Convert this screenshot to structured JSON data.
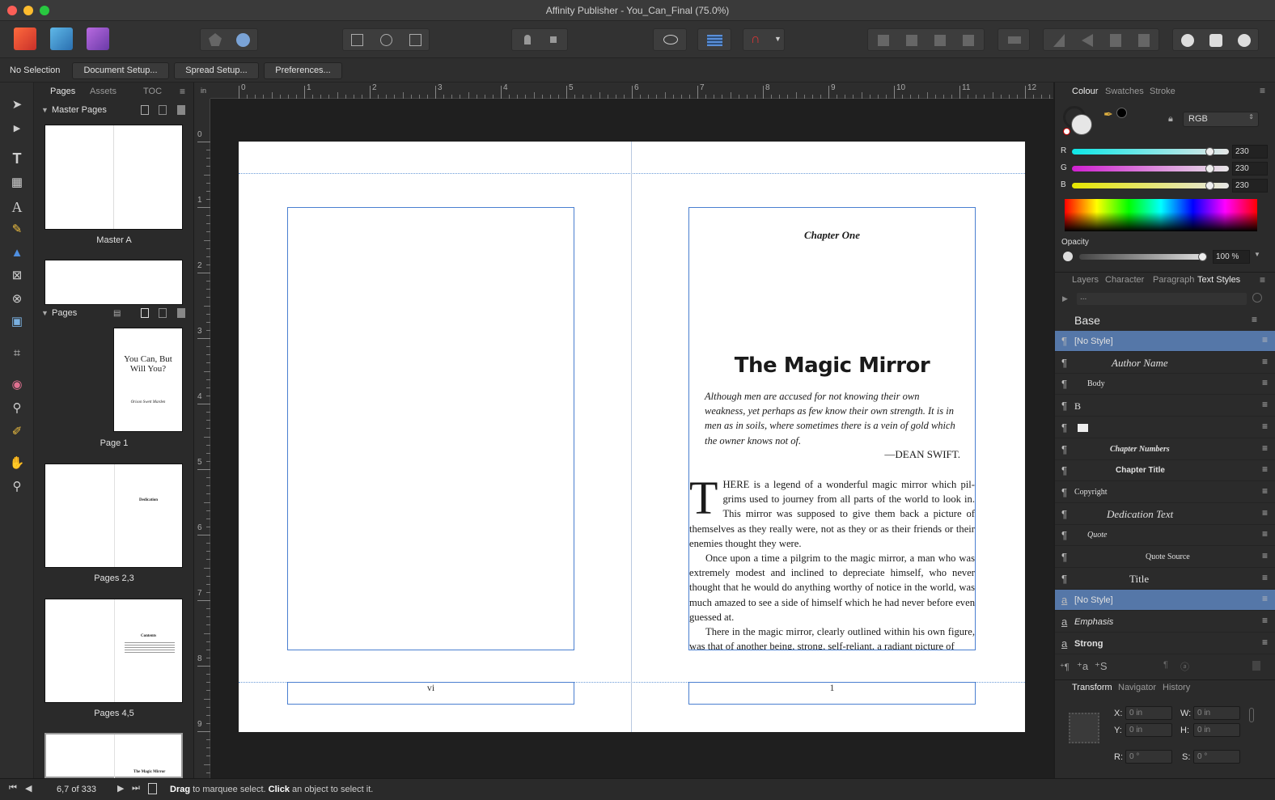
{
  "window": {
    "title": "Affinity Publisher - You_Can_Final (75.0%)"
  },
  "context_bar": {
    "selection": "No Selection",
    "document_setup": "Document Setup...",
    "spread_setup": "Spread Setup...",
    "preferences": "Preferences..."
  },
  "pages_panel": {
    "tabs": [
      "Pages",
      "Assets",
      "TOC"
    ],
    "master_pages_header": "Master Pages",
    "pages_header": "Pages",
    "master_a_label": "Master A",
    "page1_label": "Page 1",
    "page1_thumb_title": "You Can, But Will You?",
    "page1_thumb_author": "Orison Swett Marden",
    "pages23_label": "Pages 2,3",
    "pages23_thumb_text": "Dedication",
    "pages45_label": "Pages 4,5",
    "pages45_thumb_text": "Contents",
    "pages67_thumb_text": "The Magic Mirror"
  },
  "ruler": {
    "h_ticks": [
      "0",
      "1",
      "2",
      "3",
      "4",
      "5",
      "6",
      "7",
      "8",
      "9",
      "10",
      "11",
      "12"
    ],
    "v_ticks": [
      "0",
      "1",
      "2",
      "3",
      "4",
      "5",
      "6",
      "7",
      "8",
      "9"
    ],
    "unit": "in"
  },
  "spread": {
    "chapter_label": "Chapter One",
    "chapter_title": "The Magic Mirror",
    "epigraph": "Although men are accused for not knowing their own weakness, yet perhaps as few know their own strength. It is in men as in soils, where sometimes there is a vein of gold which the owner knows not of.",
    "epigraph_source": "—DEAN SWIFT.",
    "drop_cap": "T",
    "para1": "HERE is a legend of a wonderful magic mirror which pil­grims used to journey from all parts of the world to look in. This mirror was supposed to give them back a picture of themselves as they really were, not as they or as their friends or their enemies thought they were.",
    "para2": "Once upon a time a pilgrim to the magic mirror, a man who was extremely modest and inclined to depreciate himself, who never thought that he would do anything worthy of notice in the world, was much amazed to see a side of himself which he had never before even guessed at.",
    "para3": "There in the magic mirror, clearly outlined within his own figure, was that of another being, strong, self-reliant, a radiant picture of",
    "left_folio": "vi",
    "right_folio": "1"
  },
  "colour_panel": {
    "tabs": [
      "Colour",
      "Swatches",
      "Stroke"
    ],
    "model": "RGB",
    "r_label": "R",
    "r": "230",
    "g_label": "G",
    "g": "230",
    "b_label": "B",
    "b": "230",
    "opacity_label": "Opacity",
    "opacity": "100 %"
  },
  "styles_panel": {
    "tabs": [
      "Layers",
      "Character",
      "Paragraph",
      "Text Styles"
    ],
    "search_value": "...",
    "group": "Base",
    "paragraph_styles": [
      {
        "name": "[No Style]"
      },
      {
        "name": "Author Name"
      },
      {
        "name": "Body"
      },
      {
        "name": "B"
      },
      {
        "name": ""
      },
      {
        "name": "Chapter Numbers"
      },
      {
        "name": "Chapter Title"
      },
      {
        "name": "Copyright"
      },
      {
        "name": "Dedication Text"
      },
      {
        "name": "Quote"
      },
      {
        "name": "Quote Source"
      },
      {
        "name": "Title"
      }
    ],
    "character_styles": [
      {
        "name": "[No Style]"
      },
      {
        "name": "Emphasis"
      },
      {
        "name": "Strong"
      }
    ]
  },
  "transform_panel": {
    "tabs": [
      "Transform",
      "Navigator",
      "History"
    ],
    "x_label": "X:",
    "x": "0 in",
    "y_label": "Y:",
    "y": "0 in",
    "w_label": "W:",
    "w": "0 in",
    "h_label": "H:",
    "h": "0 in",
    "r_label": "R:",
    "r": "0 °",
    "s_label": "S:",
    "s": "0 °"
  },
  "status": {
    "page_indicator": "6,7 of 333",
    "hint_drag": "Drag",
    "hint_mid": " to marquee select. ",
    "hint_click": "Click",
    "hint_end": " an object to select it."
  },
  "colors": {
    "accent": "#5577a8",
    "frame": "#4a7fd0"
  }
}
